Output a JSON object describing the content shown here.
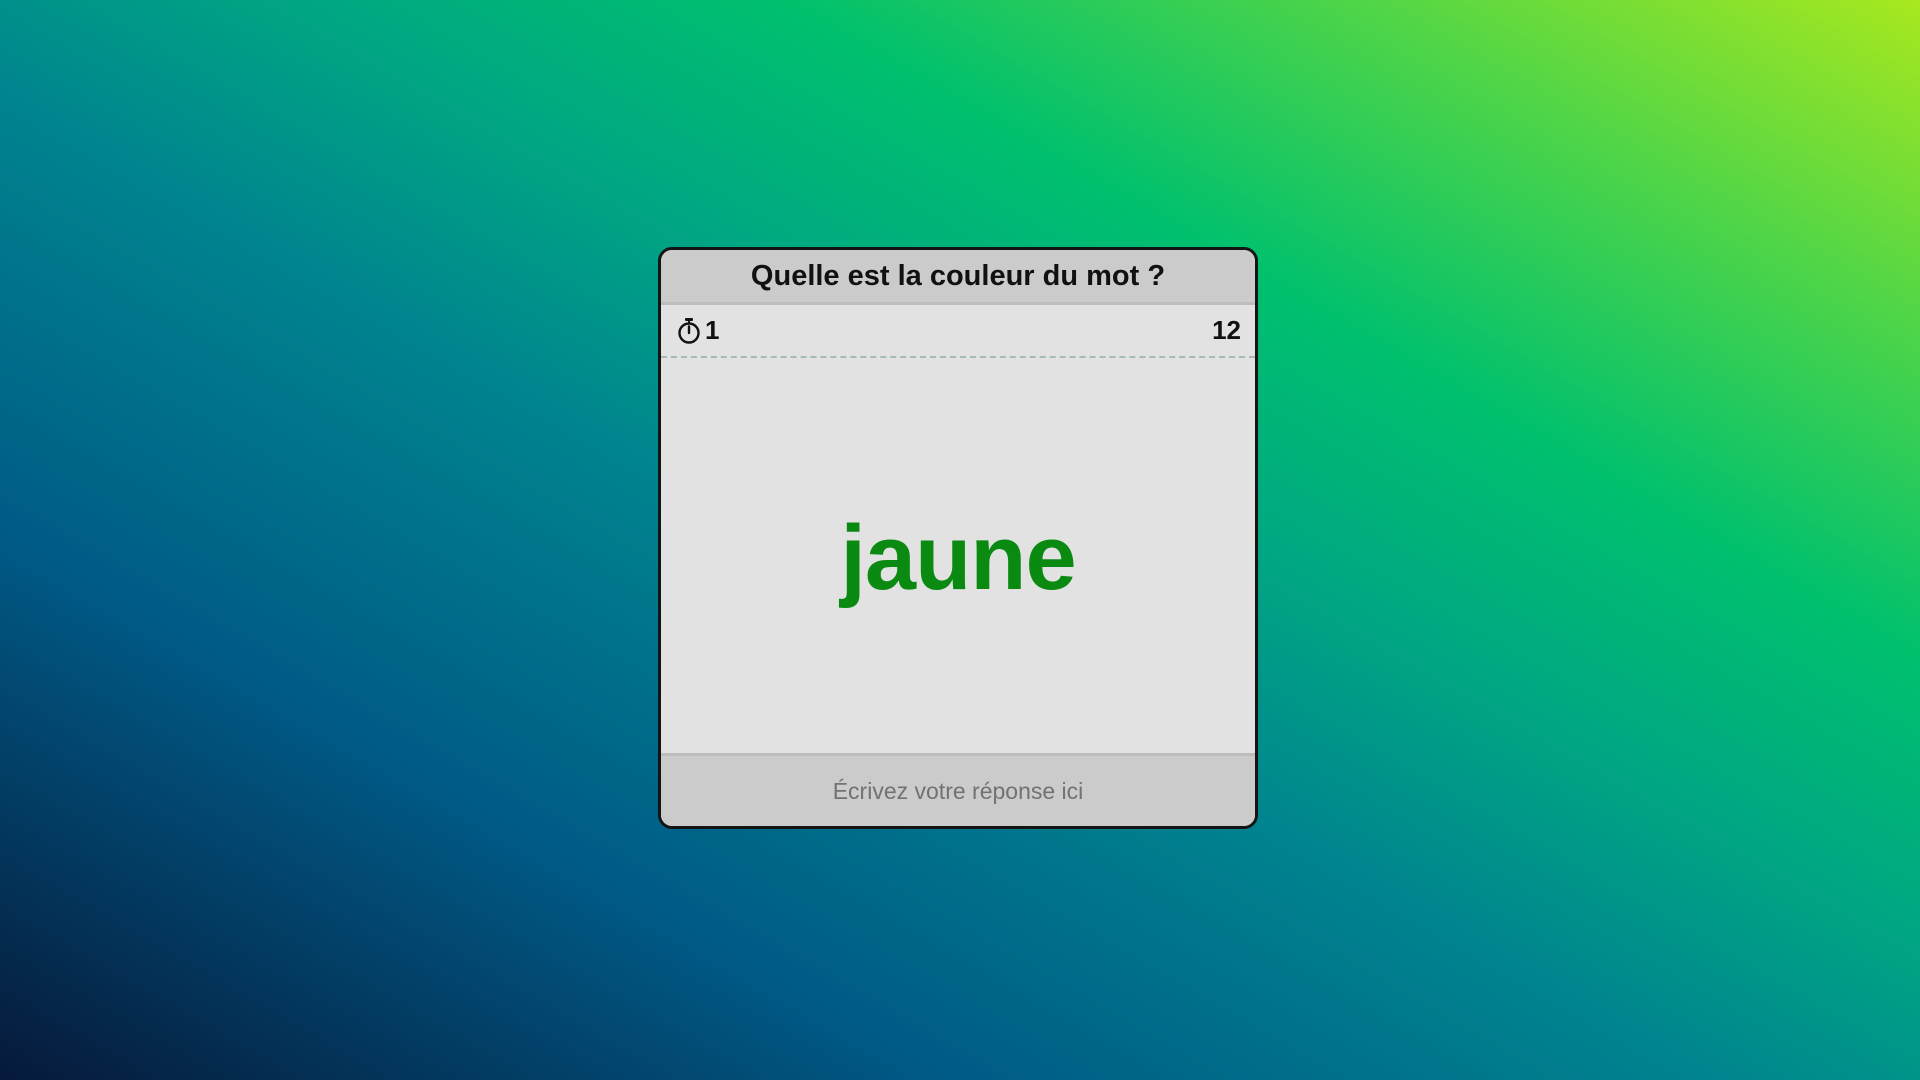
{
  "game": {
    "question": "Quelle est la couleur du mot ?",
    "timer_icon": "stopwatch-icon",
    "timer_value": "1",
    "score": "12",
    "word": "jaune",
    "word_color": "#0b8a12",
    "answer_placeholder": "Écrivez votre réponse ici",
    "answer_value": ""
  },
  "colors": {
    "card_background": "#e2e2e2",
    "header_background": "#cbcbcb",
    "border": "#141414"
  }
}
